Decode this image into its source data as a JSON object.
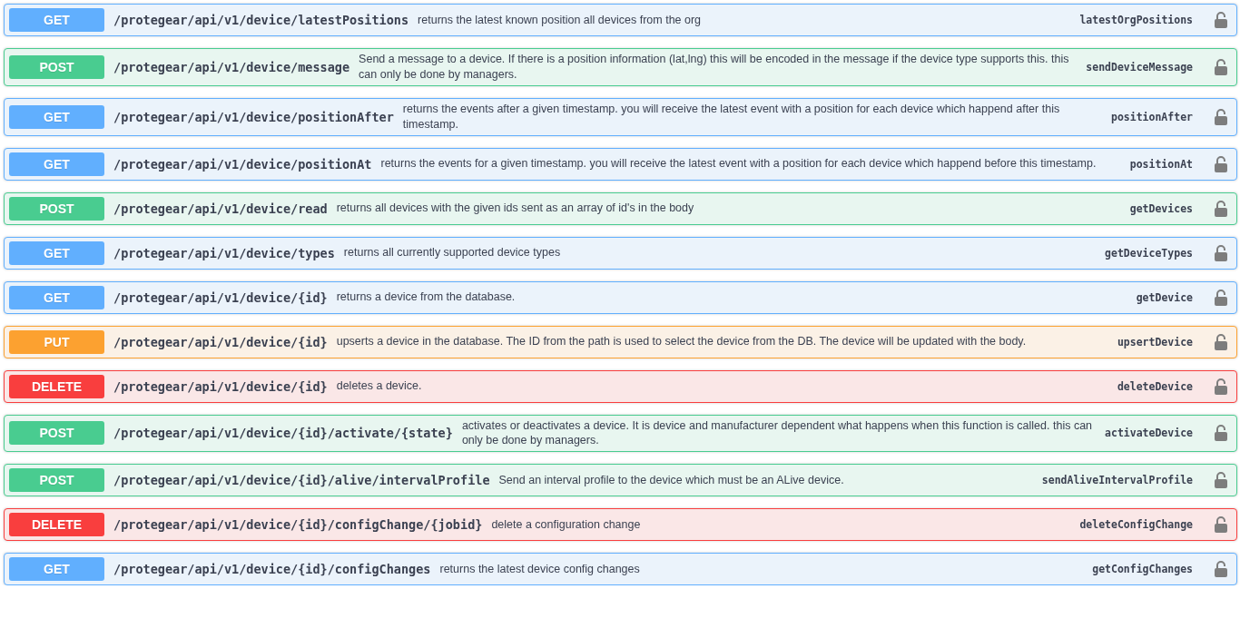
{
  "operations": [
    {
      "method": "GET",
      "path": "/protegear/api/v1/device/latestPositions",
      "description": "returns the latest known position all devices from the org",
      "operation_id": "latestOrgPositions"
    },
    {
      "method": "POST",
      "path": "/protegear/api/v1/device/message",
      "description": "Send a message to a device. If there is a position information (lat,lng) this will be encoded in the message if the device type supports this. this can only be done by managers.",
      "operation_id": "sendDeviceMessage"
    },
    {
      "method": "GET",
      "path": "/protegear/api/v1/device/positionAfter",
      "description": "returns the events after a given timestamp. you will receive the latest event with a position for each device which happend after this timestamp.",
      "operation_id": "positionAfter"
    },
    {
      "method": "GET",
      "path": "/protegear/api/v1/device/positionAt",
      "description": "returns the events for a given timestamp. you will receive the latest event with a position for each device which happend before this timestamp.",
      "operation_id": "positionAt"
    },
    {
      "method": "POST",
      "path": "/protegear/api/v1/device/read",
      "description": "returns all devices with the given ids sent as an array of id's in the body",
      "operation_id": "getDevices"
    },
    {
      "method": "GET",
      "path": "/protegear/api/v1/device/types",
      "description": "returns all currently supported device types",
      "operation_id": "getDeviceTypes"
    },
    {
      "method": "GET",
      "path": "/protegear/api/v1/device/{id}",
      "description": "returns a device from the database.",
      "operation_id": "getDevice"
    },
    {
      "method": "PUT",
      "path": "/protegear/api/v1/device/{id}",
      "description": "upserts a device in the database. The ID from the path is used to select the device from the DB. The device will be updated with the body.",
      "operation_id": "upsertDevice"
    },
    {
      "method": "DELETE",
      "path": "/protegear/api/v1/device/{id}",
      "description": "deletes a device.",
      "operation_id": "deleteDevice"
    },
    {
      "method": "POST",
      "path": "/protegear/api/v1/device/{id}/activate/{state}",
      "description": "activates or deactivates a device. It is device and manufacturer dependent what happens when this function is called. this can only be done by managers.",
      "operation_id": "activateDevice"
    },
    {
      "method": "POST",
      "path": "/protegear/api/v1/device/{id}/alive/intervalProfile",
      "description": "Send an interval profile to the device which must be an ALive device.",
      "operation_id": "sendAliveIntervalProfile"
    },
    {
      "method": "DELETE",
      "path": "/protegear/api/v1/device/{id}/configChange/{jobid}",
      "description": "delete a configuration change",
      "operation_id": "deleteConfigChange"
    },
    {
      "method": "GET",
      "path": "/protegear/api/v1/device/{id}/configChanges",
      "description": "returns the latest device config changes",
      "operation_id": "getConfigChanges"
    }
  ]
}
